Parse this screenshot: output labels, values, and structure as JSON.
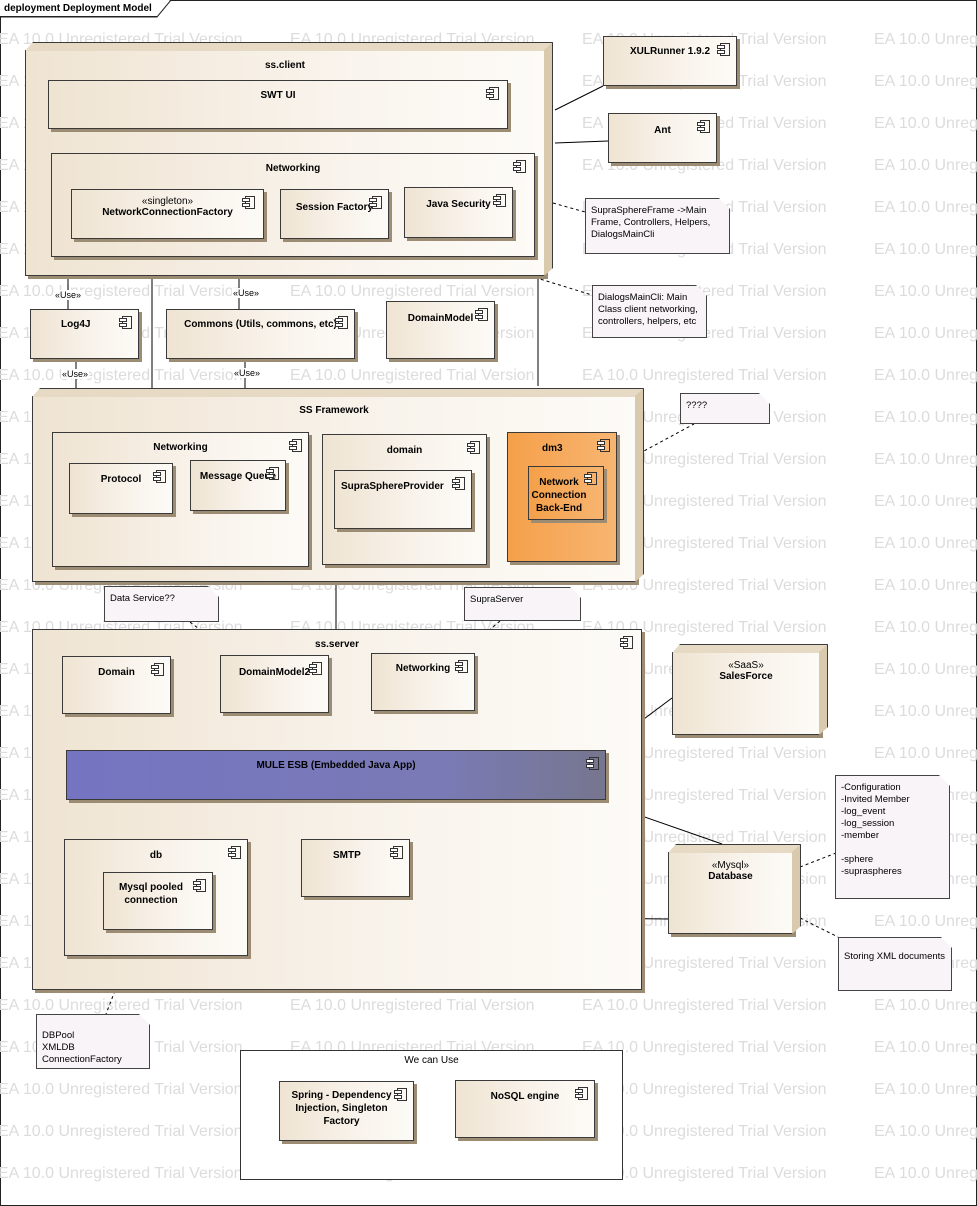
{
  "frame": {
    "title": "deployment Deployment Model"
  },
  "watermark": "EA 10.0 Unregistered Trial Version",
  "nodes": {
    "ss_client": "ss.client",
    "swt_ui": "SWT UI",
    "client_networking": "Networking",
    "ncf_stereo": "«singleton»",
    "ncf": "NetworkConnectionFactory",
    "session_factory": "Session Factory",
    "java_security": "Java Security",
    "xulrunner": "XULRunner 1.9.2",
    "ant": "Ant",
    "log4j": "Log4J",
    "commons": "Commons (Utils, commons, etc)",
    "domain_model": "DomainModel",
    "ss_framework": "SS Framework",
    "fw_networking": "Networking",
    "protocol": "Protocol",
    "message_queue": "Message Queue",
    "fw_domain": "domain",
    "supra_provider": "SupraSphereProvider",
    "dm3": "dm3",
    "ncbe": "Network Connection Back-End",
    "ss_server": "ss.server",
    "srv_domain": "Domain",
    "domain_model2": "DomainModel2",
    "srv_networking": "Networking",
    "mule": "MULE ESB (Embedded Java App)",
    "db": "db",
    "mysql_pooled": "Mysql pooled connection",
    "smtp": "SMTP",
    "salesforce_stereo": "«SaaS»",
    "salesforce": "SalesForce",
    "database_stereo": "«Mysql»",
    "database": "Database",
    "we_can_use": "We can Use",
    "spring": "Spring - Dependency Injection, Singleton Factory",
    "nosql": "NoSQL engine"
  },
  "uses": [
    "«Use»",
    "«Use»",
    "«Use»",
    "«Use»"
  ],
  "notes": {
    "suprasphere_frame": "SupraSphereFrame ->Main Frame, Controllers, Helpers, DialogsMainCli",
    "dialogs_main_cli": "DialogsMainCli: Main Class client networking, controllers, helpers, etc",
    "question": "????",
    "data_service": "Data Service??",
    "supra_server": "SupraServer",
    "db_tables": "-Configuration\n-Invited Member\n-log_event\n-log_session\n-member\n\n-sphere\n-supraspheres",
    "xml_docs": "Storing XML documents",
    "dbpool": "DBPool\nXMLDB\nConnectionFactory"
  },
  "colors": {
    "node_fill": "#efe4d2",
    "dm3_fill": "#f5a04a",
    "mule_fill": "#7676c0",
    "note_fill": "#f8f4f7"
  }
}
